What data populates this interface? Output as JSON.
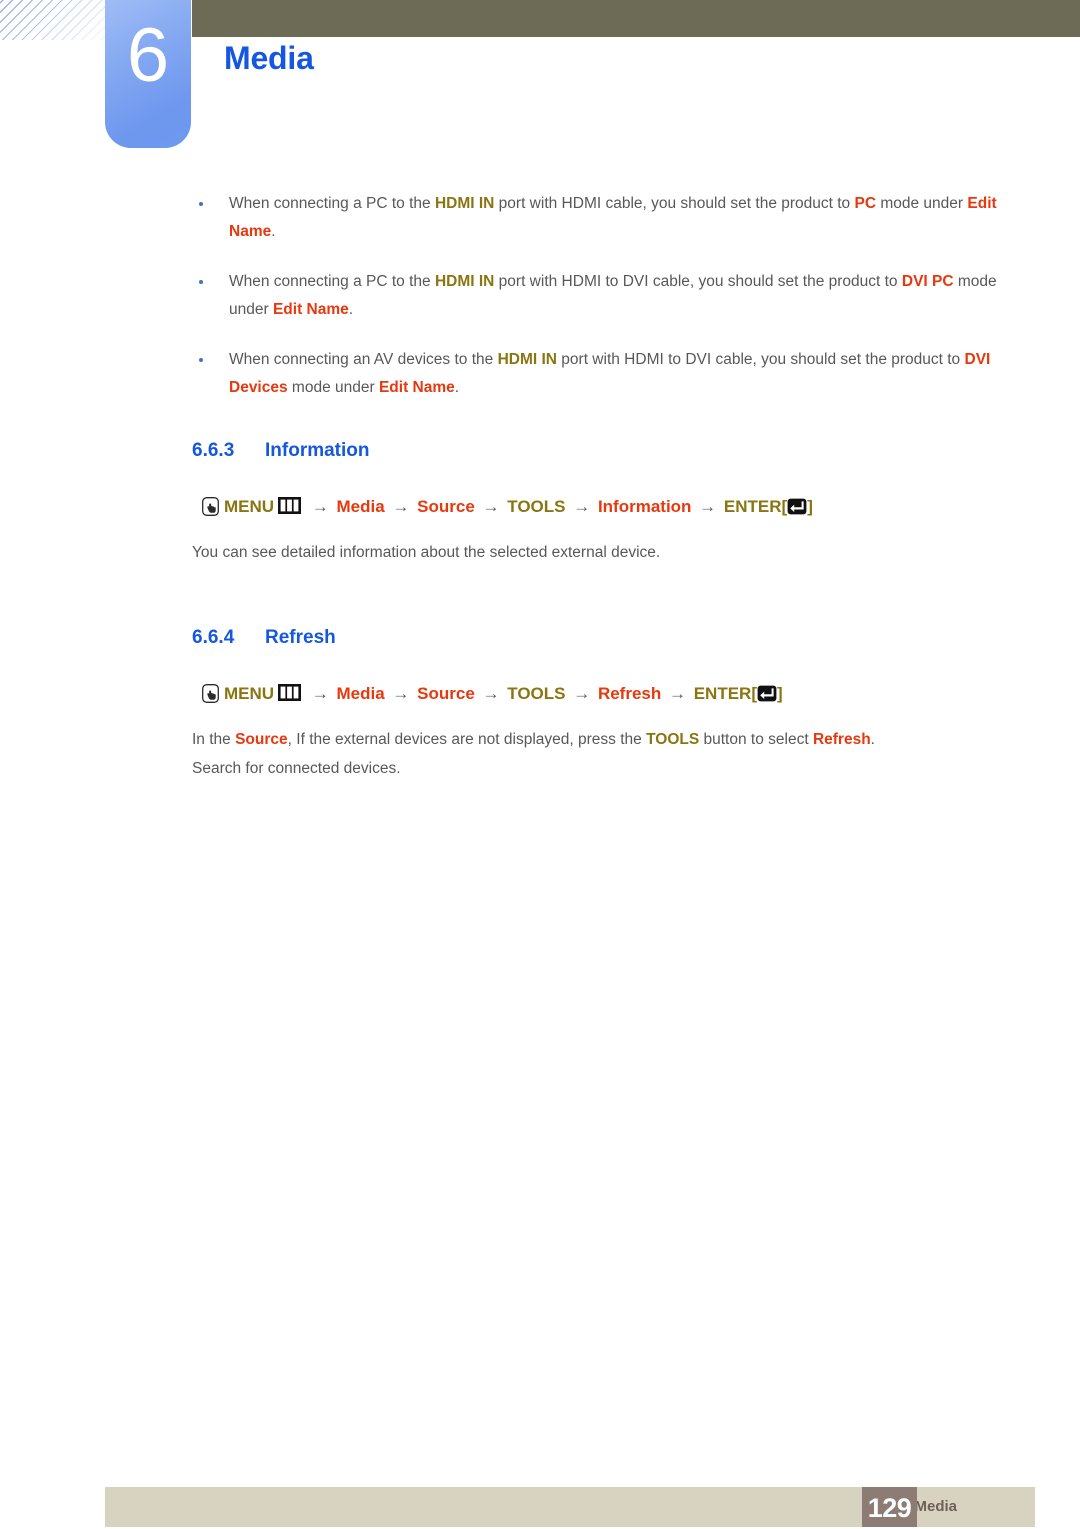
{
  "header": {
    "chapter_number": "6",
    "chapter_title": "Media",
    "accent_blue": "#1557e0",
    "olive_bar_color": "#6d6a56",
    "tab_color": "#86aaf2"
  },
  "notes": [
    {
      "segments": [
        {
          "t": "When connecting a PC to the ",
          "s": "plain"
        },
        {
          "t": "HDMI IN",
          "s": "olive"
        },
        {
          "t": " port with HDMI cable, you should set the product to ",
          "s": "plain"
        },
        {
          "t": "PC",
          "s": "red"
        },
        {
          "t": " mode under ",
          "s": "plain"
        },
        {
          "t": "Edit Name",
          "s": "red"
        },
        {
          "t": ".",
          "s": "plain"
        }
      ]
    },
    {
      "segments": [
        {
          "t": "When connecting a PC to the ",
          "s": "plain"
        },
        {
          "t": "HDMI IN",
          "s": "olive"
        },
        {
          "t": " port with HDMI to DVI cable, you should set the product to ",
          "s": "plain"
        },
        {
          "t": "DVI PC",
          "s": "red"
        },
        {
          "t": " mode under ",
          "s": "plain"
        },
        {
          "t": "Edit Name",
          "s": "red"
        },
        {
          "t": ".",
          "s": "plain"
        }
      ]
    },
    {
      "segments": [
        {
          "t": "When connecting an AV devices to the ",
          "s": "plain"
        },
        {
          "t": "HDMI IN",
          "s": "olive"
        },
        {
          "t": " port with HDMI to DVI cable, you should set the product to ",
          "s": "plain"
        },
        {
          "t": "DVI Devices",
          "s": "red"
        },
        {
          "t": " mode under ",
          "s": "plain"
        },
        {
          "t": "Edit Name",
          "s": "red"
        },
        {
          "t": ".",
          "s": "plain"
        }
      ]
    }
  ],
  "sections": [
    {
      "number": "6.6.3",
      "title": "Information",
      "path": {
        "hand_icon": "hand-pointer-icon",
        "menu_label": "MENU",
        "menu_icon": "menu-grid-icon",
        "arrow": "→",
        "steps": [
          {
            "label": "Media",
            "style": "red"
          },
          {
            "label": "Source",
            "style": "red"
          },
          {
            "label": "TOOLS",
            "style": "olive"
          },
          {
            "label": "Information",
            "style": "red"
          }
        ],
        "enter_label": "ENTER",
        "bracket_open": "[",
        "bracket_close": "]",
        "enter_icon": "enter-key-icon"
      },
      "body": [
        {
          "segments": [
            {
              "t": "You can see detailed information about the selected external device.",
              "s": "plain"
            }
          ]
        }
      ]
    },
    {
      "number": "6.6.4",
      "title": "Refresh",
      "path": {
        "hand_icon": "hand-pointer-icon",
        "menu_label": "MENU",
        "menu_icon": "menu-grid-icon",
        "arrow": "→",
        "steps": [
          {
            "label": "Media",
            "style": "red"
          },
          {
            "label": "Source",
            "style": "red"
          },
          {
            "label": "TOOLS",
            "style": "olive"
          },
          {
            "label": "Refresh",
            "style": "red"
          }
        ],
        "enter_label": "ENTER",
        "bracket_open": "[",
        "bracket_close": "]",
        "enter_icon": "enter-key-icon"
      },
      "body": [
        {
          "segments": [
            {
              "t": "In the ",
              "s": "plain"
            },
            {
              "t": "Source",
              "s": "red"
            },
            {
              "t": ", If the external devices are not displayed, press the ",
              "s": "plain"
            },
            {
              "t": "TOOLS",
              "s": "olive"
            },
            {
              "t": " button to select ",
              "s": "plain"
            },
            {
              "t": "Refresh",
              "s": "red"
            },
            {
              "t": ".",
              "s": "plain"
            }
          ]
        },
        {
          "segments": [
            {
              "t": "Search for connected devices.",
              "s": "plain"
            }
          ]
        }
      ]
    }
  ],
  "footer": {
    "label": "6 Media",
    "page_number": "129",
    "bar_color": "#d8d3c1",
    "page_box_color": "#8d7c74"
  },
  "colors": {
    "red_highlight": "#e8380d",
    "olive_highlight": "#8a7510",
    "body_text": "#58585a",
    "heading_blue": "#1557e0"
  }
}
